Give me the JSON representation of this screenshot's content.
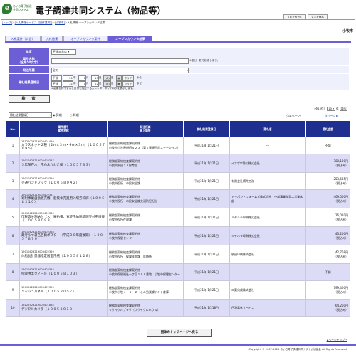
{
  "header": {
    "logo_mark": "e",
    "logo_text": "あいち電子調達共同システム",
    "system_title": "電子調達共同システム（物品等）",
    "font_large": "文字を大きく",
    "font_standard": "文字を標準"
  },
  "breadcrumb": {
    "items": [
      "[トップ]",
      "[入札情報サービス（団体選択）]",
      "[小牧市]"
    ],
    "sep": "＞",
    "tail": "入札情報:オープンカウンタ結果",
    "prefix": "＞"
  },
  "municipality": "小牧市",
  "tabs": [
    "入札案件（公告）",
    "入札結果",
    "オープンカウンタ案件",
    "オープンカウンタ結果"
  ],
  "form": {
    "year_label": "年度",
    "year_value": "平成30年度",
    "name_label": "案件名称",
    "name_label2": "（全角50文字）",
    "name_value": "",
    "name_note": "※部分一致で検索します。",
    "dept_label": "発注所属",
    "dept_value": "全て",
    "date_label": "開札結果登録日",
    "from_era": "平成",
    "from_y": "31",
    "from_m": "1",
    "from_d": "15",
    "from_day": "(火)",
    "to_era": "平成",
    "to_y": "31",
    "to_m": "1",
    "to_d": "22",
    "to_day": "(火)",
    "unit_y": "年",
    "unit_m": "月",
    "unit_d": "日",
    "clear": "クリア",
    "from_suffix": "から",
    "to_suffix": "まで",
    "cal_note": "※画像を押下すると日付を指定するカレンダーダイアログを表示します。",
    "search_button": "検　索",
    "cal_icon": "▦"
  },
  "list_controls": {
    "sort_value": "開札結果登録日",
    "asc": "昇順",
    "desc": "降順",
    "count_text": "（全10件）",
    "page_size": "10",
    "page_size_suffix": "件",
    "apply": "表示",
    "page_info": "（1/1ページ）",
    "next": "次ページ"
  },
  "table": {
    "headers": {
      "no": "No.",
      "case": "案件番号\n案件名称",
      "dept": "発注所属\n納入場所",
      "date": "開札結果登録日",
      "winner": "落札者",
      "amount": "落札金額"
    },
    "rows": [
      {
        "no": "1",
        "code": "18122023219000401440",
        "name": "カラスネット２種（２ｍ×３ｍ・４ｍ×３ｍ）（１００５７８９５）",
        "dept": "総務部契約検査課契約係",
        "place": "小牧市小牧原新田４２３（第１資源回収ステーション）",
        "date": "平成31年 1月21日",
        "winner": "---",
        "amount": "不調",
        "amount2": ""
      },
      {
        "no": "2",
        "code": "19010423219000402357",
        "name": "５年保存水　空心水かわこ部（１００５７８３）",
        "dept": "総務部契約検査課契約係",
        "place": "小牧市安田１５保育園",
        "date": "平成31年 1月21日",
        "winner": "イナザワ防災株式会社",
        "amount": "700,100円",
        "amount2": "（税込み）"
      },
      {
        "no": "3",
        "code": "19010423219000402356",
        "name": "交通ハンドブック（１００５８０４２）",
        "dept": "総務部契約検査課契約係",
        "place": "小牧市役所　市民安全課",
        "date": "平成31年 1月21日",
        "winner": "有限会社横井工務",
        "amount": "253,635円",
        "amount2": "（税込み）"
      },
      {
        "no": "4",
        "code": "19010423219000402361",
        "name": "寄附事業自動販売機一般競争売買用入場券印刷（１００５８２１０）",
        "dept": "総務部契約検査課契約係",
        "place": "小牧市役所　市民安全課交通防犯担当",
        "date": "平成31年 1月21日",
        "winner": "トッパン・フォームズ株式会社　中部事業部第二営業本部",
        "amount": "469,500円",
        "amount2": "（税込み）"
      },
      {
        "no": "5",
        "code": "19010423219000402360",
        "name": "市税等分割納付（入）審約書、査証用納税証明交付申請書（１００５８０９３）",
        "dept": "総務部契約検査課契約係",
        "place": "小牧市役所在税課",
        "date": "平成31年 1月21日",
        "winner": "ミヤハラ印刷株式会社",
        "amount": "26,020円",
        "amount2": "（税込み）"
      },
      {
        "no": "6",
        "code": "19010423219000402358",
        "name": "蔵寺うつ著名啓発ポスター（平成３０年度後期）（１００５７８７６）",
        "dept": "総務部契約検査課契約係",
        "place": "小牧市保健センター",
        "date": "平成31年 1月21日",
        "winner": "ミヤハラ印刷株式会社",
        "amount": "43,200円",
        "amount2": "（税込み）"
      },
      {
        "no": "7",
        "code": "19010423219000402359",
        "name": "体脂肪計量器指定居室用紙（１００５８１２８）",
        "dept": "総務部契約検査課契約係",
        "place": "小牧市役所　保険年金課　医療係",
        "date": "平成31年 1月21日",
        "winner": "秋田印刷株式会社",
        "amount": "42,768円",
        "amount2": "（税込み）"
      },
      {
        "no": "8",
        "code": "19010423219000402354",
        "name": "指導用エタノール（１００５８１０３）",
        "dept": "総務部契約検査課契約係",
        "place": "小牧市保健福祉一丁目１８８番地　小牧市保健センター",
        "date": "平成31年 1月21日",
        "winner": "---",
        "amount": "不調",
        "amount2": ""
      },
      {
        "no": "9",
        "code": "19010423219000402355",
        "name": "メッシュパネル（１００５８０５７）",
        "dept": "総務部契約検査課契約係",
        "place": "小牧市小牧４－５－２（こみ処業課テント倉庫）",
        "date": "平成31年 1月21日",
        "winner": "二葉化成株式会社",
        "amount": "799,400円",
        "amount2": "（税込み）"
      },
      {
        "no": "10",
        "code": "18122523219000401884",
        "name": "デジタルカメラ（１００５８０１８）",
        "dept": "総務部契約検査課契約係",
        "place": "リサイクルプラザ（リサイクルハウス）",
        "date": "平成31年 1月18日",
        "winner": "丹羽電化サービス",
        "amount": "64,260円",
        "amount2": "（税込み）"
      }
    ]
  },
  "bottom": {
    "top_button": "団体のトップページへ戻る",
    "page_top": "▲ページトップへ",
    "copyright": "Copyright © 2007-2021 あいち電子調達共同システム協議会 All Rights Reserved."
  },
  "colors": {
    "accent": "#6c5fd6",
    "table_header": "#1f2f8f",
    "row_alt": "#dcdcf6",
    "link": "#1a3fa8"
  }
}
